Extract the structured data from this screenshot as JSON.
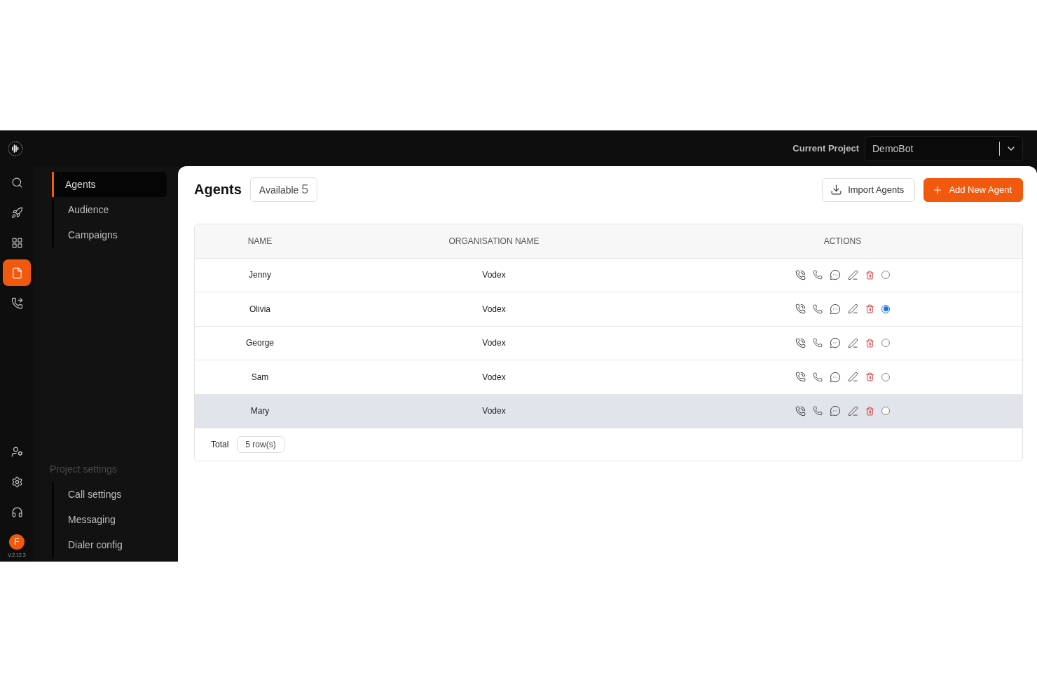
{
  "topbar": {
    "project_label": "Current Project",
    "project_value": "DemoBot"
  },
  "rail": {
    "items": [
      {
        "selected": false
      },
      {
        "selected": false
      },
      {
        "selected": false
      },
      {
        "selected": true
      },
      {
        "selected": false
      }
    ],
    "bottom_items": [
      {
        "selected": false
      },
      {
        "selected": false
      },
      {
        "selected": false
      }
    ],
    "avatar": "F",
    "version": "V.2.12.3"
  },
  "subnav": {
    "items": [
      {
        "label": "Agents",
        "selected": true
      },
      {
        "label": "Audience",
        "selected": false
      },
      {
        "label": "Campaigns",
        "selected": false
      }
    ],
    "section_title": "Project settings",
    "section_items": [
      {
        "label": "Call settings",
        "selected": false
      },
      {
        "label": "Messaging",
        "selected": false
      },
      {
        "label": "Dialer config",
        "selected": false
      }
    ]
  },
  "page": {
    "title": "Agents",
    "badge_label": "Available",
    "badge_count": "5",
    "import_button": "Import Agents",
    "add_button": "Add New Agent"
  },
  "table": {
    "columns": [
      "NAME",
      "ORGANISATION NAME",
      "ACTIONS"
    ],
    "rows": [
      {
        "name": "Jenny",
        "organisation": "Vodex",
        "selected": false,
        "hovered": false
      },
      {
        "name": "Olivia",
        "organisation": "Vodex",
        "selected": true,
        "hovered": false
      },
      {
        "name": "George",
        "organisation": "Vodex",
        "selected": false,
        "hovered": false
      },
      {
        "name": "Sam",
        "organisation": "Vodex",
        "selected": false,
        "hovered": false
      },
      {
        "name": "Mary",
        "organisation": "Vodex",
        "selected": false,
        "hovered": true
      }
    ],
    "total_label": "Total",
    "total_value": "5 row(s)"
  }
}
